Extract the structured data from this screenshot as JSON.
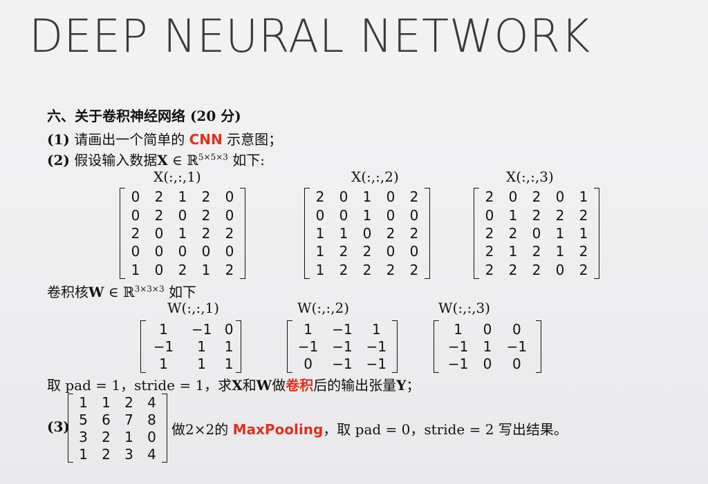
{
  "slide_title": "DEEP NEURAL NETWORK",
  "q6_header": "六、关于卷积神经网络 (20 分)",
  "q1": {
    "num": "(1)",
    "pre": " 请画出一个简单的 ",
    "highlight": "CNN",
    "post": " 示意图；"
  },
  "q2": {
    "num": "(2)",
    "pre": " 假设输入数据",
    "var": "X",
    "set": " ∈ ℝ",
    "dims": "5×5×3",
    "post": " 如下:"
  },
  "x_labels": [
    "X(:,:,1)",
    "X(:,:,2)",
    "X(:,:,3)"
  ],
  "x_matrices": [
    [
      [
        "0",
        "2",
        "1",
        "2",
        "0"
      ],
      [
        "0",
        "2",
        "0",
        "2",
        "0"
      ],
      [
        "2",
        "0",
        "1",
        "2",
        "2"
      ],
      [
        "0",
        "0",
        "0",
        "0",
        "0"
      ],
      [
        "1",
        "0",
        "2",
        "1",
        "2"
      ]
    ],
    [
      [
        "2",
        "0",
        "1",
        "0",
        "2"
      ],
      [
        "0",
        "0",
        "1",
        "0",
        "0"
      ],
      [
        "1",
        "1",
        "0",
        "2",
        "2"
      ],
      [
        "1",
        "2",
        "2",
        "0",
        "0"
      ],
      [
        "1",
        "2",
        "2",
        "2",
        "2"
      ]
    ],
    [
      [
        "2",
        "0",
        "2",
        "0",
        "1"
      ],
      [
        "0",
        "1",
        "2",
        "2",
        "2"
      ],
      [
        "2",
        "2",
        "0",
        "1",
        "1"
      ],
      [
        "2",
        "1",
        "2",
        "1",
        "2"
      ],
      [
        "2",
        "2",
        "2",
        "0",
        "2"
      ]
    ]
  ],
  "kernel_line": {
    "pre": "卷积核",
    "var": "W",
    "set": " ∈ ℝ",
    "dims": "3×3×3",
    "post": " 如下"
  },
  "w_labels": [
    "W(:,:,1)",
    "W(:,:,2)",
    "W(:,:,3)"
  ],
  "w_matrices": [
    [
      [
        "1",
        "−1",
        "0"
      ],
      [
        "−1",
        "1",
        "1"
      ],
      [
        "1",
        "1",
        "1"
      ]
    ],
    [
      [
        "1",
        "−1",
        "1"
      ],
      [
        "−1",
        "−1",
        "−1"
      ],
      [
        "0",
        "−1",
        "−1"
      ]
    ],
    [
      [
        "1",
        "0",
        "0"
      ],
      [
        "−1",
        "1",
        "−1"
      ],
      [
        "−1",
        "0",
        "0"
      ]
    ]
  ],
  "conv_line": {
    "pre": "取 pad = 1，stride = 1，求",
    "x": "X",
    "and": "和",
    "w": "W",
    "mid": "做",
    "highlight": "卷积",
    "post": "后的输出张量",
    "y": "Y",
    "end": "；"
  },
  "q3": {
    "num": "(3)",
    "matrix": [
      [
        "1",
        "1",
        "2",
        "4"
      ],
      [
        "5",
        "6",
        "7",
        "8"
      ],
      [
        "3",
        "2",
        "1",
        "0"
      ],
      [
        "1",
        "2",
        "3",
        "4"
      ]
    ],
    "pre": "做2×2的 ",
    "highlight": "MaxPooling",
    "post": "，取 pad = 0，stride = 2 写出结果。"
  },
  "colors": {
    "accent_red": "#e0301e",
    "title_gray": "#3a3a3a"
  }
}
